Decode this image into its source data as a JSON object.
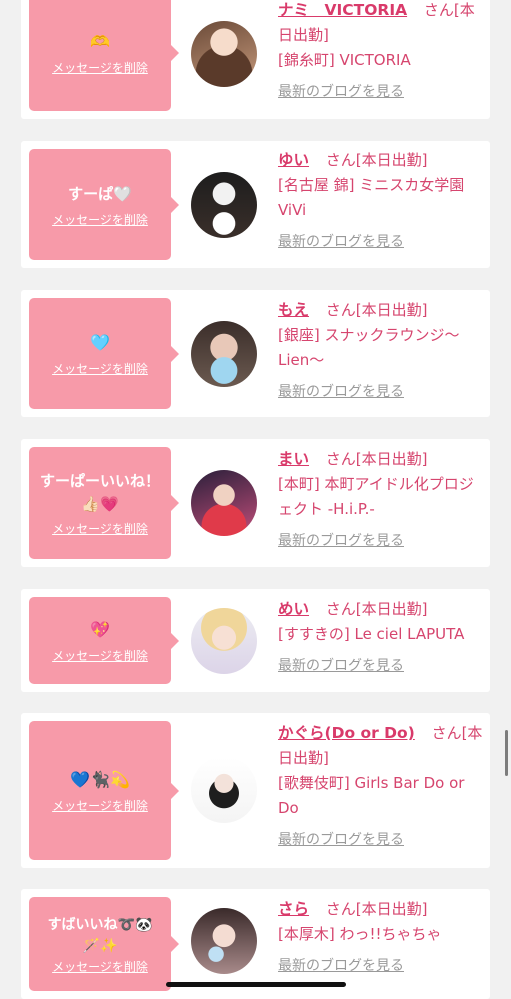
{
  "posts": [
    {
      "message_emoji": "🫶",
      "delete_label": "メッセージを削除",
      "avatar_icon": "profile-photo-icon",
      "name": "ナミ　VICTORIA",
      "honorific": "さん[本日出勤]",
      "shop": "[錦糸町] VICTORIA",
      "blog_link": "最新のブログを見る"
    },
    {
      "message_text": "すーぱ",
      "message_emoji": "🤍",
      "delete_label": "メッセージを削除",
      "avatar_icon": "profile-photo-icon",
      "name": "ゆい",
      "honorific": "さん[本日出勤]",
      "shop": "[名古屋 錦] ミニスカ女学園ViVi",
      "blog_link": "最新のブログを見る"
    },
    {
      "message_emoji": "🩵",
      "delete_label": "メッセージを削除",
      "avatar_icon": "profile-photo-icon",
      "name": "もえ",
      "honorific": "さん[本日出勤]",
      "shop": "[銀座] スナックラウンジ〜Lien〜",
      "blog_link": "最新のブログを見る"
    },
    {
      "message_text": "すーぱーいいね！",
      "message_emoji": "👍🏻💗",
      "delete_label": "メッセージを削除",
      "avatar_icon": "profile-photo-icon",
      "name": "まい",
      "honorific": "さん[本日出勤]",
      "shop": "[本町] 本町アイドル化プロジェクト -H.i.P.-",
      "blog_link": "最新のブログを見る"
    },
    {
      "message_emoji": "💖",
      "delete_label": "メッセージを削除",
      "avatar_icon": "profile-photo-icon",
      "name": "めい",
      "honorific": "さん[本日出勤]",
      "shop": "[すすきの] Le ciel LAPUTA",
      "blog_link": "最新のブログを見る"
    },
    {
      "message_emoji": "💙🐈‍⬛💫",
      "delete_label": "メッセージを削除",
      "avatar_icon": "profile-photo-icon",
      "name": "かぐら(Do or Do)",
      "honorific": "さん[本日出勤]",
      "shop": "[歌舞伎町] Girls Bar Do or Do",
      "blog_link": "最新のブログを見る"
    },
    {
      "message_text": "すばいいね➰🐼",
      "message_emoji": "🪄✨",
      "delete_label": "メッセージを削除",
      "avatar_icon": "profile-photo-icon",
      "name": "さら",
      "honorific": "さん[本日出勤]",
      "shop": "[本厚木] わっ!!ちゃちゃ",
      "blog_link": "最新のブログを見る"
    }
  ],
  "colors": {
    "page_background": "#f1f1f1",
    "card_background": "#ffffff",
    "bubble_pink": "#f79aa9",
    "name_pink": "#d93a6a",
    "link_gray": "#9a9a9a"
  }
}
